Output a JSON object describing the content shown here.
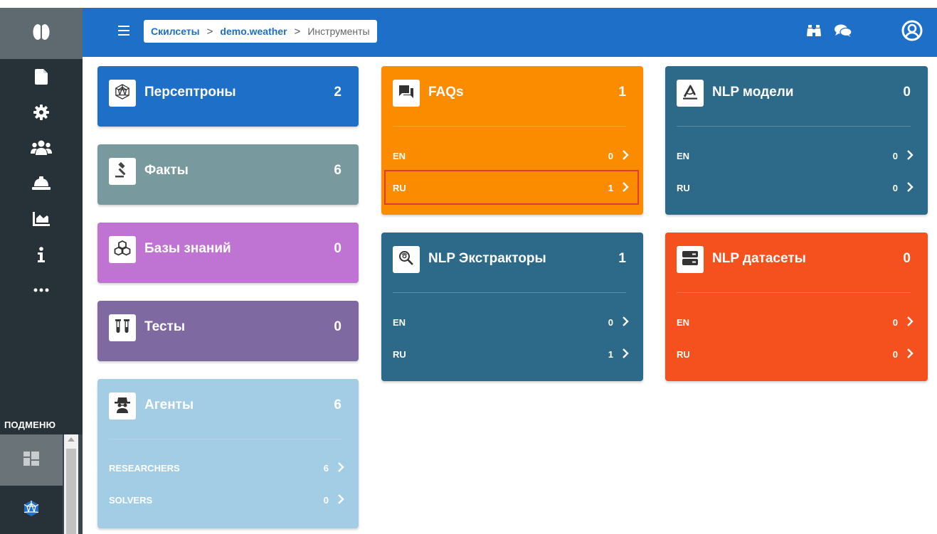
{
  "colors": {
    "header": "#1e6fc8",
    "sidebar": "#263238",
    "perceptrons": "#1e6fc8",
    "facts": "#78999d",
    "knowledge_bases": "#bf73d2",
    "tests": "#7e6aa1",
    "agents": "#a3cde5",
    "faqs": "#fb8c00",
    "nlp_extractors": "#2d6a8a",
    "nlp_models": "#2d6a8a",
    "nlp_datasets": "#f4511e"
  },
  "sidebar": {
    "logo_icon": "brain-icon",
    "items": [
      {
        "icon": "file-icon"
      },
      {
        "icon": "gear-icon"
      },
      {
        "icon": "users-icon"
      },
      {
        "icon": "helmet-icon"
      },
      {
        "icon": "area-chart-icon"
      },
      {
        "icon": "info-icon"
      },
      {
        "icon": "more-icon"
      }
    ],
    "submenu_label": "ПОДМЕНЮ",
    "submenu_items": [
      {
        "icon": "dashboard-icon"
      },
      {
        "icon": "perceptron-icon"
      }
    ]
  },
  "header": {
    "breadcrumb": {
      "items": [
        "Скилсеты",
        "demo.weather"
      ],
      "separator": ">",
      "current": "Инструменты"
    },
    "icons": [
      "binoculars-icon",
      "chat-icon",
      "user-circle-icon"
    ]
  },
  "cards": {
    "perceptrons": {
      "title": "Персептроны",
      "count": "2",
      "icon": "perceptron-icon"
    },
    "facts": {
      "title": "Факты",
      "count": "6",
      "icon": "gavel-icon"
    },
    "knowledge_bases": {
      "title": "Базы знаний",
      "count": "0",
      "icon": "cubes-icon"
    },
    "tests": {
      "title": "Тесты",
      "count": "0",
      "icon": "test-tubes-icon"
    },
    "agents": {
      "title": "Агенты",
      "count": "6",
      "icon": "spy-icon",
      "rows": [
        {
          "label": "RESEARCHERS",
          "value": "6"
        },
        {
          "label": "SOLVERS",
          "value": "0"
        }
      ]
    },
    "faqs": {
      "title": "FAQs",
      "count": "1",
      "icon": "comments-icon",
      "rows": [
        {
          "label": "EN",
          "value": "0"
        },
        {
          "label": "RU",
          "value": "1"
        }
      ]
    },
    "nlp_extractors": {
      "title": "NLP Экстракторы",
      "count": "1",
      "icon": "search-icon",
      "rows": [
        {
          "label": "EN",
          "value": "0"
        },
        {
          "label": "RU",
          "value": "1"
        }
      ]
    },
    "nlp_models": {
      "title": "NLP модели",
      "count": "0",
      "icon": "compass-icon",
      "rows": [
        {
          "label": "EN",
          "value": "0"
        },
        {
          "label": "RU",
          "value": "0"
        }
      ]
    },
    "nlp_datasets": {
      "title": "NLP датасеты",
      "count": "0",
      "icon": "server-icon",
      "rows": [
        {
          "label": "EN",
          "value": "0"
        },
        {
          "label": "RU",
          "value": "0"
        }
      ]
    }
  }
}
